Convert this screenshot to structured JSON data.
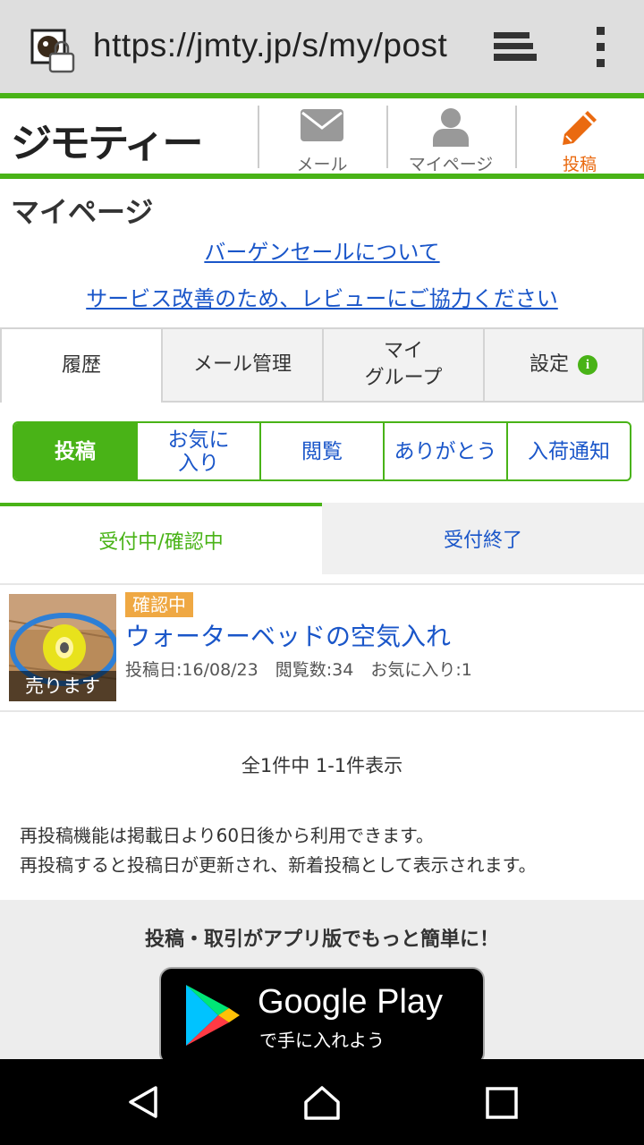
{
  "browser": {
    "url": "https://jmty.jp/s/my/post"
  },
  "header": {
    "logo": "ジモティー",
    "nav": {
      "mail": "メール",
      "mypage": "マイページ",
      "post": "投稿"
    }
  },
  "page": {
    "title": "マイページ",
    "link_sale": "バーゲンセールについて",
    "link_review": "サービス改善のため、レビューにご協力ください"
  },
  "main_tabs": {
    "history": "履歴",
    "mail_manage": "メール管理",
    "my_group_line1": "マイ",
    "my_group_line2": "グループ",
    "settings": "設定",
    "info_glyph": "i"
  },
  "segment": {
    "post": "投稿",
    "favorites_line1": "お気に",
    "favorites_line2": "入り",
    "viewed": "閲覧",
    "thanks": "ありがとう",
    "arrival": "入荷通知"
  },
  "subtabs": {
    "active": "受付中/確認中",
    "closed": "受付終了"
  },
  "listing": {
    "thumb_caption": "売ります",
    "status": "確認中",
    "title": "ウォーターベッドの空気入れ",
    "meta": "投稿日:16/08/23　閲覧数:34　お気に入り:1"
  },
  "count_text": "全1件中 1-1件表示",
  "notes": {
    "line1": "再投稿機能は掲載日より60日後から利用できます。",
    "line2": "再投稿すると投稿日が更新され、新着投稿として表示されます。"
  },
  "promo": {
    "text": "投稿・取引がアプリ版でもっと簡単に！",
    "store_title": "Google Play",
    "store_sub": "で手に入れよう"
  },
  "colors": {
    "brand_green": "#49b317",
    "link_blue": "#1a56c9",
    "post_orange": "#ea6a10",
    "badge_orange": "#efa843"
  },
  "icons": [
    "favicon-lock-icon",
    "tabs-icon",
    "overflow-menu-icon",
    "mail-icon",
    "person-icon",
    "pencil-icon",
    "info-icon",
    "google-play-icon",
    "back-icon",
    "home-icon",
    "recents-icon"
  ]
}
